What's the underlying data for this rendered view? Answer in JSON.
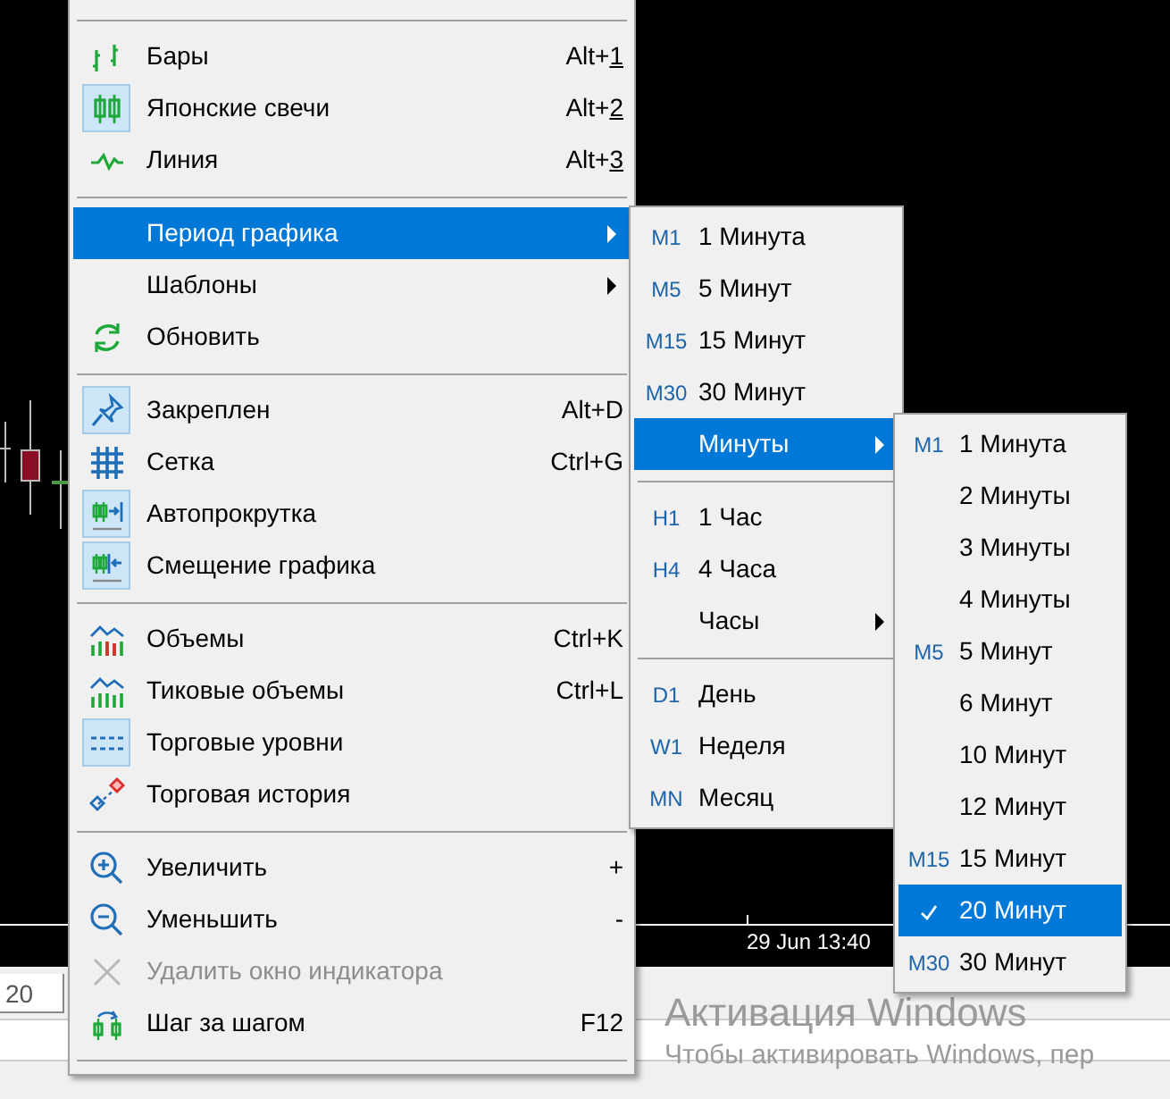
{
  "chart": {
    "time_labels": [
      "29 Jun 13:40"
    ]
  },
  "bottom_panel": {
    "tab": "20"
  },
  "activation_notice": {
    "title": "Активация Windows",
    "text": "Чтобы активировать Windows, пер"
  },
  "context_menu": {
    "items": [
      {
        "kind": "separator"
      },
      {
        "kind": "item",
        "label": "Бары",
        "shortcut": "Alt+1",
        "mnemonic_underlined": true,
        "checked": false,
        "selected": false,
        "disabled": false,
        "submenu": false
      },
      {
        "kind": "item",
        "label": "Японские свечи",
        "shortcut": "Alt+2",
        "mnemonic_underlined": true,
        "checked": true,
        "selected": false,
        "disabled": false,
        "submenu": false
      },
      {
        "kind": "item",
        "label": "Линия",
        "shortcut": "Alt+3",
        "mnemonic_underlined": true,
        "checked": false,
        "selected": false,
        "disabled": false,
        "submenu": false
      },
      {
        "kind": "separator"
      },
      {
        "kind": "item",
        "label": "Период графика",
        "checked": false,
        "selected": true,
        "disabled": false,
        "submenu": true
      },
      {
        "kind": "item",
        "label": "Шаблоны",
        "checked": false,
        "selected": false,
        "disabled": false,
        "submenu": true
      },
      {
        "kind": "item",
        "label": "Обновить",
        "checked": false,
        "selected": false,
        "disabled": false,
        "submenu": false
      },
      {
        "kind": "separator"
      },
      {
        "kind": "item",
        "label": "Закреплен",
        "shortcut": "Alt+D",
        "mnemonic_underlined": false,
        "checked": true,
        "selected": false,
        "disabled": false,
        "submenu": false
      },
      {
        "kind": "item",
        "label": "Сетка",
        "shortcut": "Ctrl+G",
        "mnemonic_underlined": false,
        "checked": false,
        "selected": false,
        "disabled": false,
        "submenu": false
      },
      {
        "kind": "item",
        "label": "Автопрокрутка",
        "checked": true,
        "selected": false,
        "disabled": false,
        "submenu": false
      },
      {
        "kind": "item",
        "label": "Смещение графика",
        "checked": true,
        "selected": false,
        "disabled": false,
        "submenu": false
      },
      {
        "kind": "separator"
      },
      {
        "kind": "item",
        "label": "Объемы",
        "shortcut": "Ctrl+K",
        "mnemonic_underlined": false,
        "checked": false,
        "selected": false,
        "disabled": false,
        "submenu": false
      },
      {
        "kind": "item",
        "label": "Тиковые объемы",
        "shortcut": "Ctrl+L",
        "mnemonic_underlined": false,
        "checked": false,
        "selected": false,
        "disabled": false,
        "submenu": false
      },
      {
        "kind": "item",
        "label": "Торговые уровни",
        "checked": true,
        "selected": false,
        "disabled": false,
        "submenu": false
      },
      {
        "kind": "item",
        "label": "Торговая история",
        "checked": false,
        "selected": false,
        "disabled": false,
        "submenu": false
      },
      {
        "kind": "separator"
      },
      {
        "kind": "item",
        "label": "Увеличить",
        "shortcut": "+",
        "mnemonic_underlined": false,
        "checked": false,
        "selected": false,
        "disabled": false,
        "submenu": false
      },
      {
        "kind": "item",
        "label": "Уменьшить",
        "shortcut": "-",
        "mnemonic_underlined": false,
        "checked": false,
        "selected": false,
        "disabled": false,
        "submenu": false
      },
      {
        "kind": "item",
        "label": "Удалить окно индикатора",
        "checked": false,
        "selected": false,
        "disabled": true,
        "submenu": false
      },
      {
        "kind": "item",
        "label": "Шаг за шагом",
        "shortcut": "F12",
        "mnemonic_underlined": false,
        "checked": false,
        "selected": false,
        "disabled": false,
        "submenu": false
      },
      {
        "kind": "separator"
      }
    ]
  },
  "period_submenu": {
    "items": [
      {
        "kind": "item",
        "code": "M1",
        "label": "1 Минута",
        "selected": false,
        "submenu": false
      },
      {
        "kind": "item",
        "code": "M5",
        "label": "5 Минут",
        "selected": false,
        "submenu": false
      },
      {
        "kind": "item",
        "code": "M15",
        "label": "15 Минут",
        "selected": false,
        "submenu": false
      },
      {
        "kind": "item",
        "code": "M30",
        "label": "30 Минут",
        "selected": false,
        "submenu": false
      },
      {
        "kind": "item",
        "label": "Минуты",
        "selected": true,
        "submenu": true
      },
      {
        "kind": "separator"
      },
      {
        "kind": "item",
        "code": "H1",
        "label": "1 Час",
        "selected": false,
        "submenu": false
      },
      {
        "kind": "item",
        "code": "H4",
        "label": "4 Часа",
        "selected": false,
        "submenu": false
      },
      {
        "kind": "item",
        "label": "Часы",
        "selected": false,
        "submenu": true
      },
      {
        "kind": "separator"
      },
      {
        "kind": "item",
        "code": "D1",
        "label": "День",
        "selected": false,
        "submenu": false
      },
      {
        "kind": "item",
        "code": "W1",
        "label": "Неделя",
        "selected": false,
        "submenu": false
      },
      {
        "kind": "item",
        "code": "MN",
        "label": "Месяц",
        "selected": false,
        "submenu": false
      }
    ]
  },
  "minutes_submenu": {
    "items": [
      {
        "code": "M1",
        "label": "1 Минута",
        "selected": false,
        "checked": false
      },
      {
        "label": "2 Минуты",
        "selected": false,
        "checked": false
      },
      {
        "label": "3 Минуты",
        "selected": false,
        "checked": false
      },
      {
        "label": "4 Минуты",
        "selected": false,
        "checked": false
      },
      {
        "code": "M5",
        "label": "5 Минут",
        "selected": false,
        "checked": false
      },
      {
        "label": "6 Минут",
        "selected": false,
        "checked": false
      },
      {
        "label": "10 Минут",
        "selected": false,
        "checked": false
      },
      {
        "label": "12 Минут",
        "selected": false,
        "checked": false
      },
      {
        "code": "M15",
        "label": "15 Минут",
        "selected": false,
        "checked": false
      },
      {
        "label": "20 Минут",
        "selected": true,
        "checked": true
      },
      {
        "code": "M30",
        "label": "30 Минут",
        "selected": false,
        "checked": false
      }
    ]
  }
}
